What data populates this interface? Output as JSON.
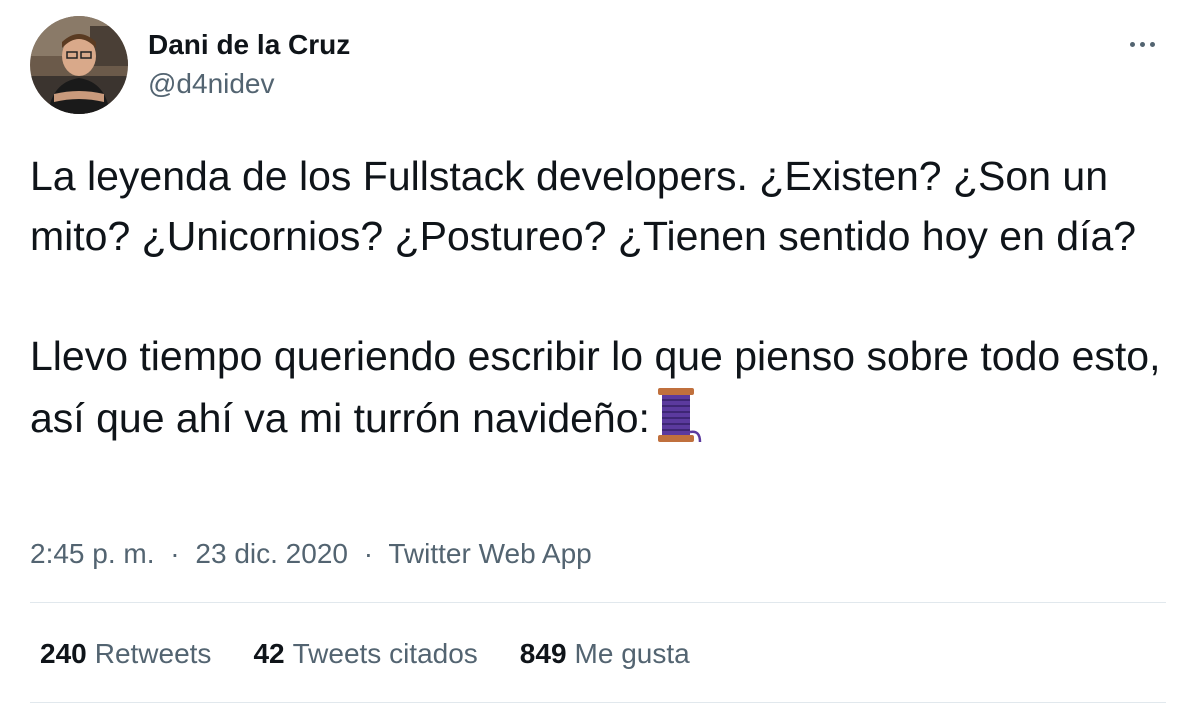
{
  "author": {
    "name": "Dani de la Cruz",
    "handle": "@d4nidev"
  },
  "tweet": {
    "paragraph_1": "La leyenda de los Fullstack developers. ¿Existen? ¿Son un mito? ¿Unicornios? ¿Postureo? ¿Tienen sentido hoy en día?",
    "paragraph_2": "Llevo tiempo queriendo escribir lo que pienso sobre todo esto, así que ahí va mi turrón navideño:",
    "emoji": "thread-spool-icon"
  },
  "meta": {
    "time": "2:45 p. m.",
    "separator": "·",
    "date": "23 dic. 2020",
    "source": "Twitter Web App"
  },
  "stats": {
    "retweets": {
      "count": "240",
      "label": "Retweets"
    },
    "quotes": {
      "count": "42",
      "label": "Tweets citados"
    },
    "likes": {
      "count": "849",
      "label": "Me gusta"
    }
  },
  "colors": {
    "text_primary": "#0f1419",
    "text_secondary": "#536471",
    "divider": "#e1e8ed",
    "spool_thread": "#5b3a9e"
  },
  "icons": {
    "more": "more-horizontal-icon"
  }
}
